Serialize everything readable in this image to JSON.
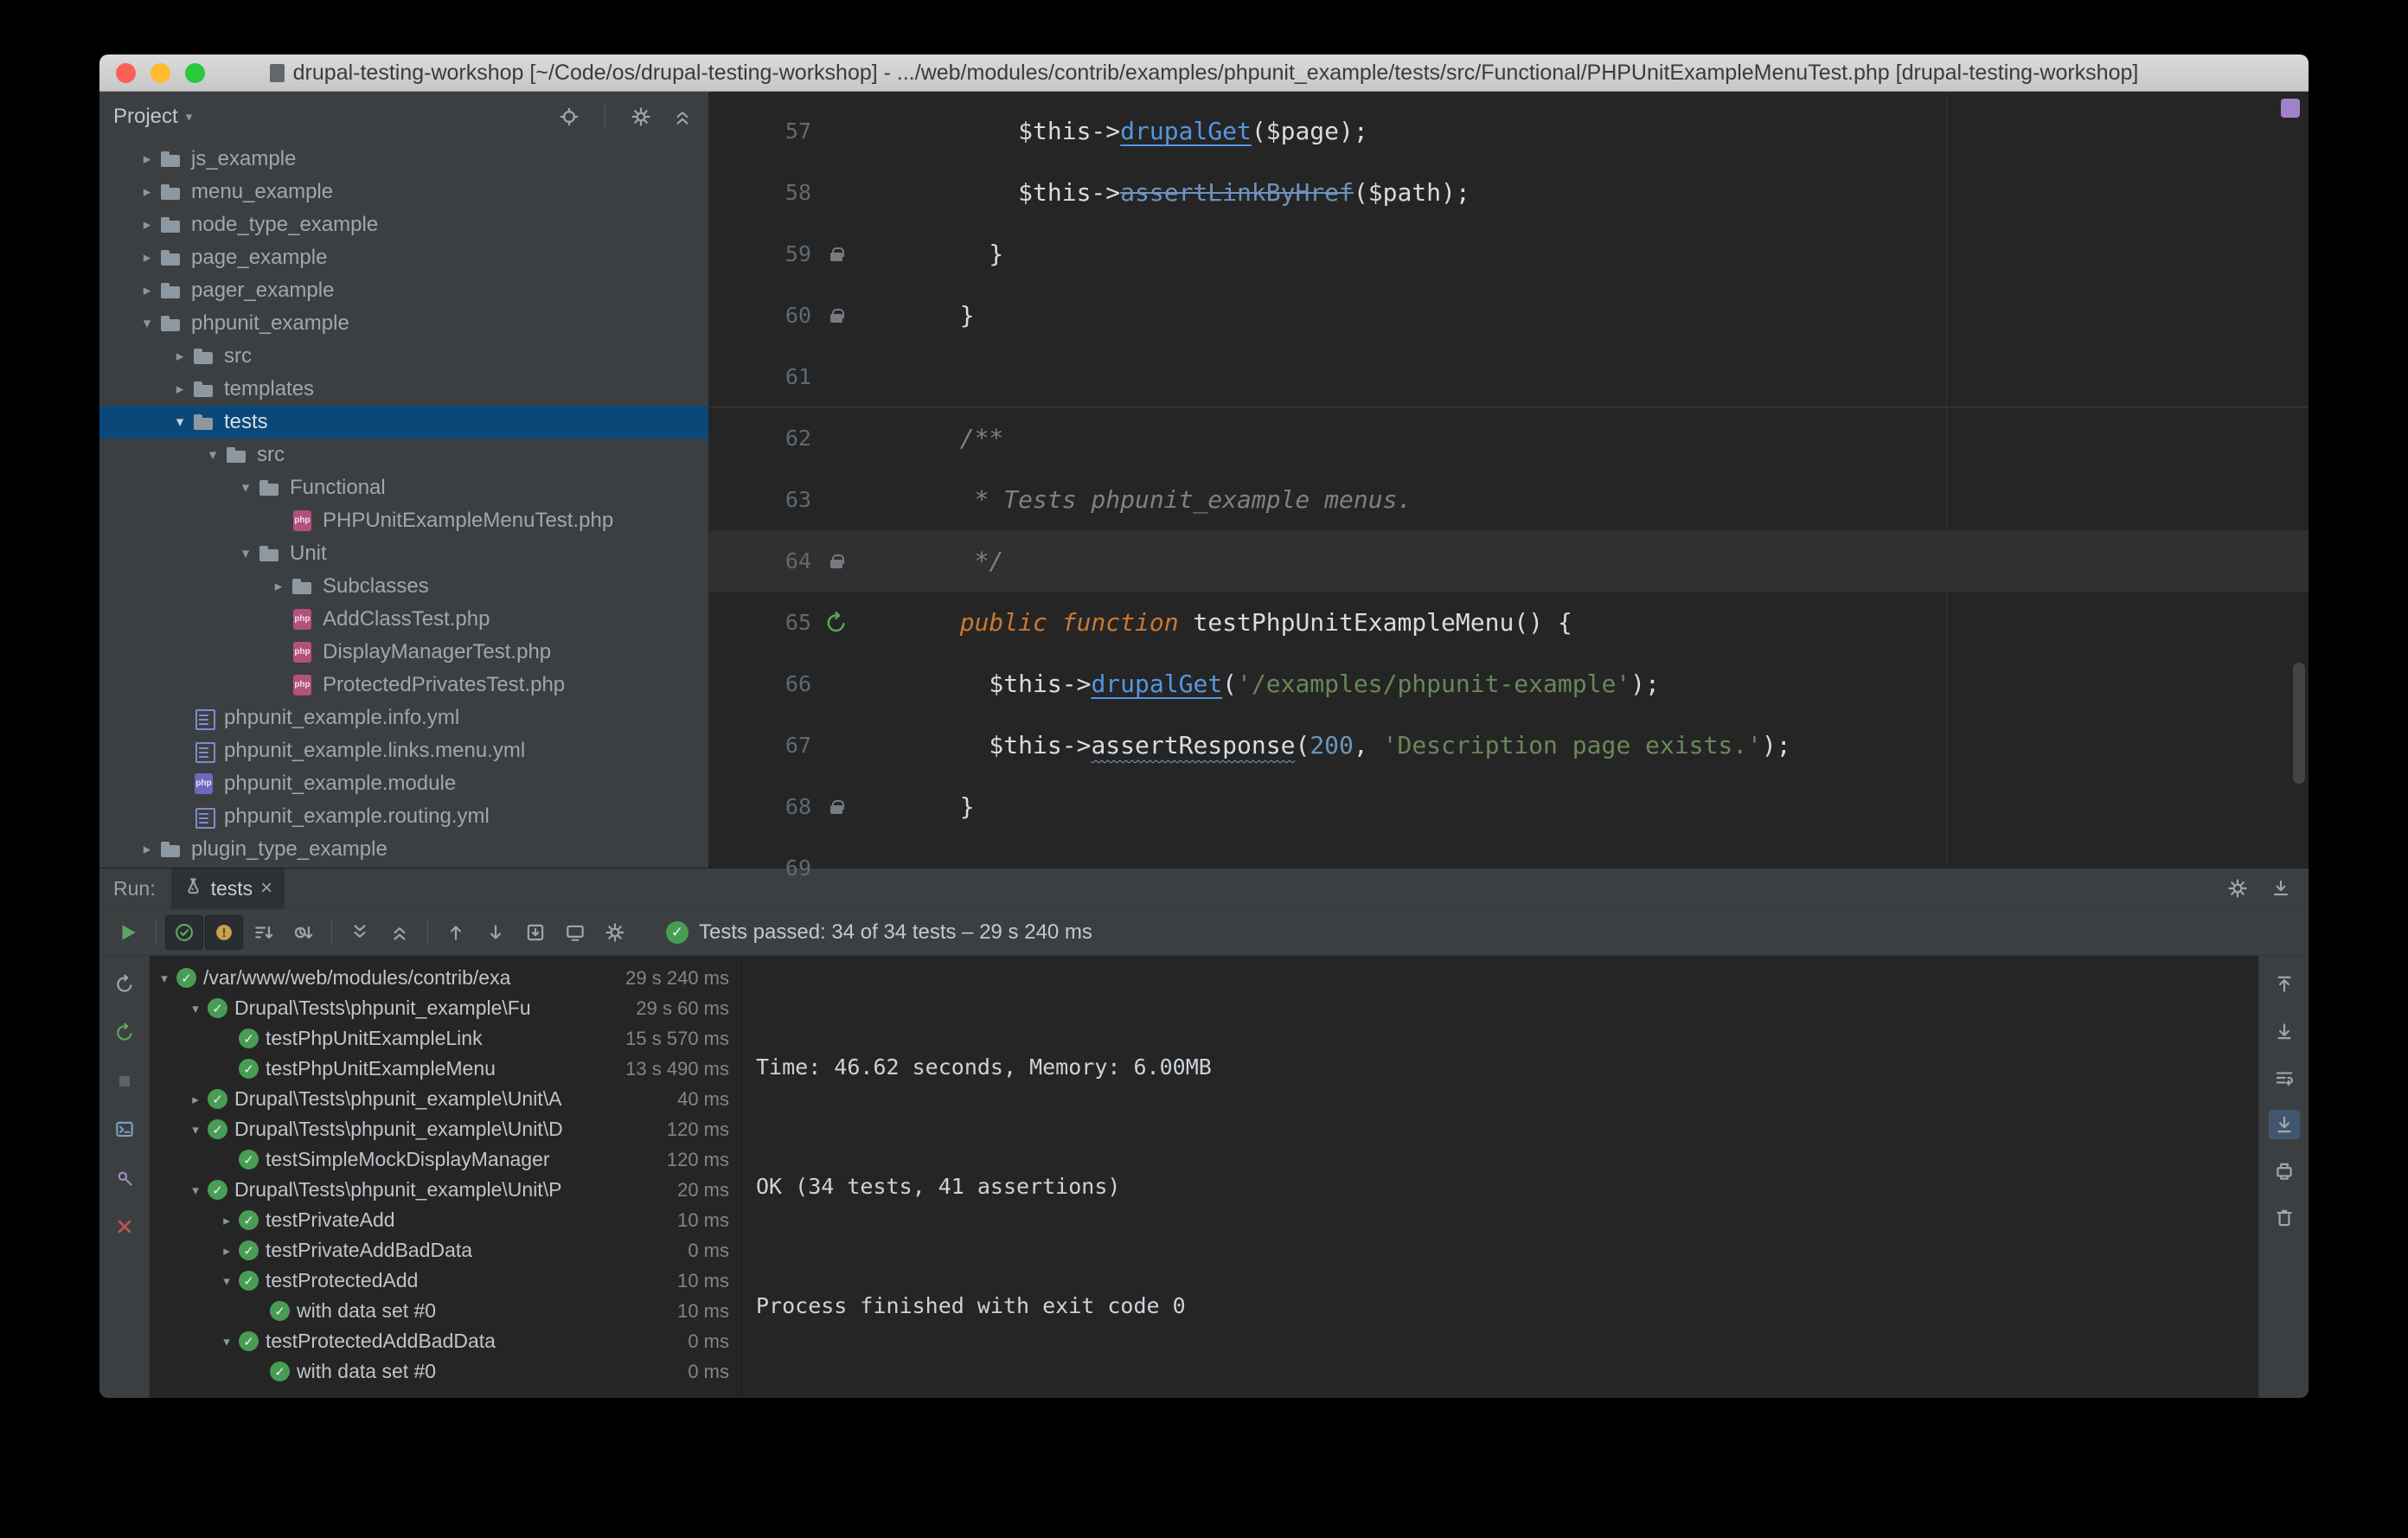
{
  "window": {
    "title": "drupal-testing-workshop [~/Code/os/drupal-testing-workshop] - .../web/modules/contrib/examples/phpunit_example/tests/src/Functional/PHPUnitExampleMenuTest.php [drupal-testing-workshop]"
  },
  "palette": {
    "selection_blue": "#0B4879",
    "pass_green": "#499C54",
    "keyword_orange": "#CC7832",
    "string_green": "#6A8759",
    "number_blue": "#6897BB",
    "method_link_blue": "#5596E0",
    "test_file_pink": "#B2517E"
  },
  "project_panel": {
    "title": "Project",
    "header_icons": [
      "locate-icon",
      "separator",
      "settings-icon",
      "collapse-all-icon"
    ],
    "tree": [
      {
        "label": "js_example",
        "level": 0,
        "kind": "folder",
        "state": "collapsed"
      },
      {
        "label": "menu_example",
        "level": 0,
        "kind": "folder",
        "state": "collapsed"
      },
      {
        "label": "node_type_example",
        "level": 0,
        "kind": "folder",
        "state": "collapsed"
      },
      {
        "label": "page_example",
        "level": 0,
        "kind": "folder",
        "state": "collapsed"
      },
      {
        "label": "pager_example",
        "level": 0,
        "kind": "folder",
        "state": "collapsed"
      },
      {
        "label": "phpunit_example",
        "level": 0,
        "kind": "folder",
        "state": "expanded"
      },
      {
        "label": "src",
        "level": 1,
        "kind": "folder",
        "state": "collapsed"
      },
      {
        "label": "templates",
        "level": 1,
        "kind": "folder",
        "state": "collapsed"
      },
      {
        "label": "tests",
        "level": 1,
        "kind": "folder",
        "state": "expanded",
        "selected": true
      },
      {
        "label": "src",
        "level": 2,
        "kind": "folder",
        "state": "expanded"
      },
      {
        "label": "Functional",
        "level": 3,
        "kind": "folder",
        "state": "expanded"
      },
      {
        "label": "PHPUnitExampleMenuTest.php",
        "level": 4,
        "kind": "php-test"
      },
      {
        "label": "Unit",
        "level": 3,
        "kind": "folder",
        "state": "expanded"
      },
      {
        "label": "Subclasses",
        "level": 4,
        "kind": "folder",
        "state": "collapsed"
      },
      {
        "label": "AddClassTest.php",
        "level": 4,
        "kind": "php-test"
      },
      {
        "label": "DisplayManagerTest.php",
        "level": 4,
        "kind": "php-test"
      },
      {
        "label": "ProtectedPrivatesTest.php",
        "level": 4,
        "kind": "php-test"
      },
      {
        "label": "phpunit_example.info.yml",
        "level": 1,
        "kind": "yml"
      },
      {
        "label": "phpunit_example.links.menu.yml",
        "level": 1,
        "kind": "yml"
      },
      {
        "label": "phpunit_example.module",
        "level": 1,
        "kind": "php-module"
      },
      {
        "label": "phpunit_example.routing.yml",
        "level": 1,
        "kind": "yml"
      },
      {
        "label": "plugin_type_example",
        "level": 0,
        "kind": "folder",
        "state": "collapsed"
      }
    ]
  },
  "editor": {
    "current_line": 64,
    "lines": [
      {
        "num": 57,
        "tokens": [
          [
            "plain",
            "      $this->"
          ],
          [
            "link",
            "drupalGet"
          ],
          [
            "plain",
            "($page);"
          ]
        ]
      },
      {
        "num": 58,
        "tokens": [
          [
            "plain",
            "      $this->"
          ],
          [
            "dep",
            "assertLinkByHref"
          ],
          [
            "plain",
            "($path);"
          ]
        ]
      },
      {
        "num": 59,
        "gutter": "lock",
        "tokens": [
          [
            "plain",
            "    }"
          ]
        ]
      },
      {
        "num": 60,
        "gutter": "lock",
        "tokens": [
          [
            "plain",
            "  }"
          ]
        ]
      },
      {
        "num": 61,
        "tokens": []
      },
      {
        "num": 62,
        "sep": true,
        "tokens": [
          [
            "com",
            "  /**"
          ]
        ]
      },
      {
        "num": 63,
        "tokens": [
          [
            "com",
            "   * Tests phpunit_example menus."
          ]
        ]
      },
      {
        "num": 64,
        "gutter": "lock",
        "tokens": [
          [
            "com",
            "   */"
          ]
        ]
      },
      {
        "num": 65,
        "gutter": "run",
        "tokens": [
          [
            "kw",
            "  public function"
          ],
          [
            "plain",
            " testPhpUnitExampleMenu() {"
          ]
        ]
      },
      {
        "num": 66,
        "tokens": [
          [
            "plain",
            "    $this->"
          ],
          [
            "link",
            "drupalGet"
          ],
          [
            "plain",
            "("
          ],
          [
            "str",
            "'/examples/phpunit-example'"
          ],
          [
            "plain",
            ");"
          ]
        ]
      },
      {
        "num": 67,
        "tokens": [
          [
            "plain",
            "    $this->"
          ],
          [
            "warn",
            "assertResponse"
          ],
          [
            "plain",
            "("
          ],
          [
            "num",
            "200"
          ],
          [
            "plain",
            ", "
          ],
          [
            "str",
            "'Description page exists.'"
          ],
          [
            "plain",
            ");"
          ]
        ]
      },
      {
        "num": 68,
        "gutter": "lock",
        "tokens": [
          [
            "plain",
            "  }"
          ]
        ]
      },
      {
        "num": 69,
        "tokens": []
      }
    ]
  },
  "run_panel": {
    "run_label": "Run:",
    "tab_title": "tests",
    "status_text": "Tests passed: 34 of 34 tests – 29 s 240 ms",
    "header_icons": [
      "settings-icon",
      "hide-icon"
    ],
    "toolbar_icons": [
      {
        "name": "rerun-tests-icon"
      },
      {
        "name": "separator"
      },
      {
        "name": "show-passed-icon",
        "pressed": true
      },
      {
        "name": "show-ignored-icon",
        "pressed": true
      },
      {
        "name": "sort-alphabetically-icon"
      },
      {
        "name": "sort-by-duration-icon"
      },
      {
        "name": "separator"
      },
      {
        "name": "expand-all-icon"
      },
      {
        "name": "collapse-all-icon"
      },
      {
        "name": "separator"
      },
      {
        "name": "previous-failed-test-icon"
      },
      {
        "name": "next-failed-test-icon"
      },
      {
        "name": "import-test-results-icon"
      },
      {
        "name": "export-test-results-icon"
      },
      {
        "name": "test-settings-icon"
      }
    ],
    "left_stripe_icons": [
      "rerun-icon",
      "rerun-failed-tests-icon",
      "stop-icon",
      "test-console-icon",
      "pin-tab-icon",
      "close-icon"
    ],
    "right_stripe_icons": [
      {
        "name": "scroll-up-icon"
      },
      {
        "name": "scroll-down-icon"
      },
      {
        "name": "soft-wrap-icon"
      },
      {
        "name": "scroll-to-end-icon",
        "active": true
      },
      {
        "name": "print-icon"
      },
      {
        "name": "clear-all-icon"
      }
    ],
    "tree": [
      {
        "label": "/var/www/web/modules/contrib/exa",
        "duration": "29 s 240 ms",
        "level": 0,
        "state": "expanded"
      },
      {
        "label": "Drupal\\Tests\\phpunit_example\\Fu",
        "duration": "29 s 60 ms",
        "level": 1,
        "state": "expanded"
      },
      {
        "label": "testPhpUnitExampleLink",
        "duration": "15 s 570 ms",
        "level": 2,
        "state": "leaf"
      },
      {
        "label": "testPhpUnitExampleMenu",
        "duration": "13 s 490 ms",
        "level": 2,
        "state": "leaf"
      },
      {
        "label": "Drupal\\Tests\\phpunit_example\\Unit\\A",
        "duration": "40 ms",
        "level": 1,
        "state": "collapsed"
      },
      {
        "label": "Drupal\\Tests\\phpunit_example\\Unit\\D",
        "duration": "120 ms",
        "level": 1,
        "state": "expanded"
      },
      {
        "label": "testSimpleMockDisplayManager",
        "duration": "120 ms",
        "level": 2,
        "state": "leaf"
      },
      {
        "label": "Drupal\\Tests\\phpunit_example\\Unit\\P",
        "duration": "20 ms",
        "level": 1,
        "state": "expanded"
      },
      {
        "label": "testPrivateAdd",
        "duration": "10 ms",
        "level": 2,
        "state": "collapsed"
      },
      {
        "label": "testPrivateAddBadData",
        "duration": "0 ms",
        "level": 2,
        "state": "collapsed"
      },
      {
        "label": "testProtectedAdd",
        "duration": "10 ms",
        "level": 2,
        "state": "expanded"
      },
      {
        "label": "with data set #0",
        "duration": "10 ms",
        "level": 3,
        "state": "leaf"
      },
      {
        "label": "testProtectedAddBadData",
        "duration": "0 ms",
        "level": 2,
        "state": "expanded"
      },
      {
        "label": "with data set #0",
        "duration": "0 ms",
        "level": 3,
        "state": "leaf"
      }
    ],
    "console": [
      "",
      "",
      "Time: 46.62 seconds, Memory: 6.00MB",
      "",
      "",
      "OK (34 tests, 41 assertions)",
      "",
      "",
      "Process finished with exit code 0"
    ]
  }
}
